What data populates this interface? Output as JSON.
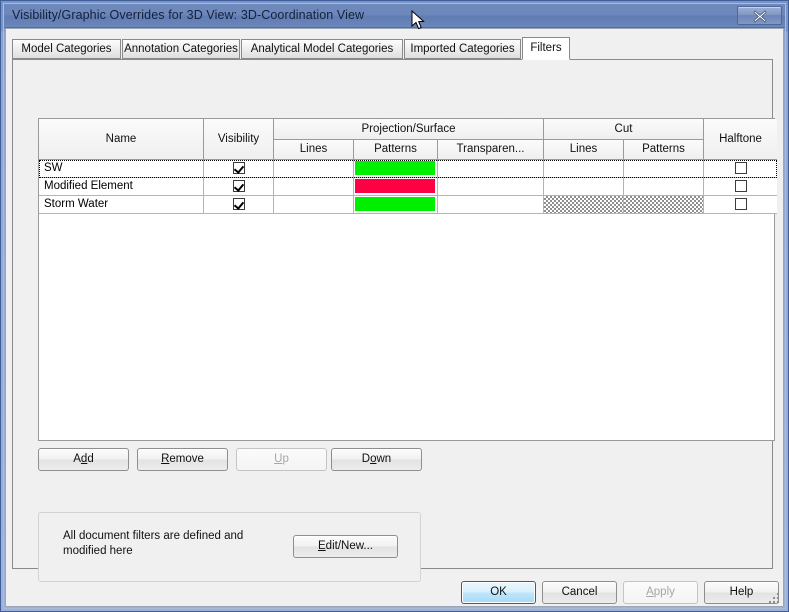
{
  "window": {
    "title": "Visibility/Graphic Overrides for 3D View: 3D-Coordination View",
    "close_label": "x"
  },
  "tabs": [
    {
      "label": "Model Categories",
      "active": false
    },
    {
      "label": "Annotation Categories",
      "active": false
    },
    {
      "label": "Analytical Model Categories",
      "active": false
    },
    {
      "label": "Imported Categories",
      "active": false
    },
    {
      "label": "Filters",
      "active": true
    }
  ],
  "grid": {
    "group_headers": [
      {
        "label": "Name",
        "span": 1
      },
      {
        "label": "Visibility",
        "span": 1
      },
      {
        "label": "Projection/Surface",
        "span": 3
      },
      {
        "label": "Cut",
        "span": 2
      },
      {
        "label": "Halftone",
        "span": 1
      }
    ],
    "sub_headers": [
      "Lines",
      "Patterns",
      "Transparen...",
      "Lines",
      "Patterns"
    ],
    "columns": [
      "Name",
      "Visibility",
      "Lines",
      "Patterns",
      "Transparen...",
      "Lines",
      "Patterns",
      "Halftone"
    ],
    "rows": [
      {
        "name": "SW",
        "visibility": true,
        "proj_lines": "",
        "proj_patterns_color": "#00ee00",
        "proj_transparency": "",
        "cut_lines": "",
        "cut_patterns": "",
        "halftone": false,
        "selected": true,
        "cut_disabled": false
      },
      {
        "name": "Modified Element",
        "visibility": true,
        "proj_lines": "",
        "proj_patterns_color": "#ff0044",
        "proj_transparency": "",
        "cut_lines": "",
        "cut_patterns": "",
        "halftone": false,
        "selected": false,
        "cut_disabled": false
      },
      {
        "name": "Storm Water",
        "visibility": true,
        "proj_lines": "",
        "proj_patterns_color": "#00ee00",
        "proj_transparency": "",
        "cut_lines": "",
        "cut_patterns": "",
        "halftone": false,
        "selected": false,
        "cut_disabled": true
      }
    ]
  },
  "list_buttons": {
    "add": {
      "pre": "A",
      "mn": "d",
      "post": "d",
      "enabled": true
    },
    "remove": {
      "pre": "",
      "mn": "R",
      "post": "emove",
      "enabled": true
    },
    "up": {
      "pre": "",
      "mn": "U",
      "post": "p",
      "enabled": false
    },
    "down": {
      "pre": "D",
      "mn": "o",
      "post": "wn",
      "enabled": true
    }
  },
  "groupbox": {
    "text": "All document filters are defined and modified here",
    "edit_button": {
      "pre": "",
      "mn": "E",
      "post": "dit/New...",
      "enabled": true
    }
  },
  "dialog_buttons": {
    "ok": {
      "label": "OK",
      "enabled": true,
      "default": true
    },
    "cancel": {
      "label": "Cancel",
      "enabled": true,
      "default": false
    },
    "apply": {
      "pre": "",
      "mn": "A",
      "post": "pply",
      "enabled": false
    },
    "help": {
      "label": "Help",
      "enabled": true,
      "default": false
    }
  },
  "colors": {
    "titlebar": "#6b87bb",
    "frame": "#7b94c4",
    "client": "#f0f0f0",
    "grid_bg": "#ffffff",
    "green_swatch": "#00ee00",
    "red_swatch": "#ff0044",
    "default_button_accent": "#bee6fd"
  }
}
